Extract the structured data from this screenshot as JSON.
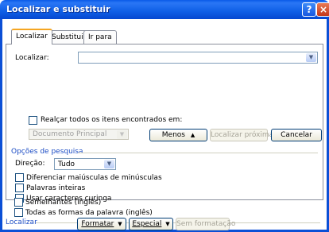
{
  "window": {
    "title": "Localizar e substituir",
    "help_glyph": "?",
    "close_glyph": "×"
  },
  "tabs": [
    {
      "label": "Localizar",
      "active": true
    },
    {
      "label": "Substituir",
      "active": false
    },
    {
      "label": "Ir para",
      "active": false
    }
  ],
  "find": {
    "label": "Localizar:",
    "value": ""
  },
  "highlight": {
    "label": "Realçar todos os itens encontrados em:",
    "checked": false,
    "dropdown_value": "Documento Principal"
  },
  "buttons": {
    "less": "Menos",
    "less_arrow": "▲",
    "find_next": "Localizar próxima",
    "cancel": "Cancelar"
  },
  "search_options": {
    "title": "Opções de pesquisa",
    "direction_label": "Direção:",
    "direction_value": "Tudo",
    "options": [
      {
        "label": "Diferenciar maiúsculas de minúsculas",
        "checked": false
      },
      {
        "label": "Palavras inteiras",
        "checked": false
      },
      {
        "label": "Usar caracteres curinga",
        "checked": false
      },
      {
        "label": "Semelhantes (inglês)",
        "checked": false
      },
      {
        "label": "Todas as formas da palavra (inglês)",
        "checked": false
      }
    ]
  },
  "footer": {
    "title": "Localizar",
    "format": "Formatar",
    "special": "Especial",
    "no_format": "Sem formatação"
  },
  "colors": {
    "titlebar": "#0a5ae8",
    "group_title": "#1b4cc4",
    "active_tab_accent": "#f5a623"
  }
}
